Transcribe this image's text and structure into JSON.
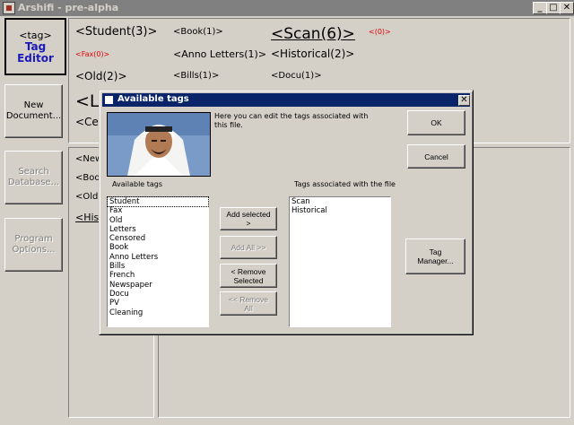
{
  "window": {
    "title": "Arshifi - pre-alpha",
    "controls": {
      "minimize": "_",
      "maximize": "□",
      "close": "✕"
    }
  },
  "nav": {
    "tag_editor": {
      "line1": "<tag>",
      "line2": "Tag",
      "line3": "Editor"
    },
    "new_document": {
      "line1": "New",
      "line2": "Document..."
    },
    "search_database": {
      "line1": "Search",
      "line2": "Database..."
    },
    "program_options": {
      "line1": "Program",
      "line2": "Options..."
    }
  },
  "tag_cloud": {
    "student": "<Student(3)>",
    "book": "<Book(1)>",
    "scan": "<Scan(6)>",
    "zero": "<(0)>",
    "fax": "<Fax(0)>",
    "anno_letters": "<Anno Letters(1)>",
    "historical": "<Historical(2)>",
    "old": "<Old(2)>",
    "bills": "<Bills(1)>",
    "docu": "<Docu(1)>",
    "le": "<Le",
    "ce": "<Ce"
  },
  "lower_panel": {
    "items": [
      "<New",
      "<Boo",
      "<Old(",
      "<Hist"
    ]
  },
  "dialog": {
    "title": "Available tags",
    "close_glyph": "✕",
    "description": "Here you can edit the tags associated with this file.",
    "available_label": "Available tags",
    "associated_label": "Tags associated with the file",
    "available_tags": [
      "Student",
      "Fax",
      "Old",
      "Letters",
      "Censored",
      "Book",
      "Anno Letters",
      "Bills",
      "French",
      "Newspaper",
      "Docu",
      "PV",
      "Cleaning"
    ],
    "associated_tags": [
      "Scan",
      "Historical"
    ],
    "buttons": {
      "ok": "OK",
      "cancel": "Cancel",
      "add_selected": "Add selected >",
      "add_all": "Add All >>",
      "remove_selected_1": "< Remove",
      "remove_selected_2": "Selected",
      "remove_all": "<< Remove All",
      "tag_manager": "Tag Manager..."
    }
  },
  "colors": {
    "face": "#d4d0c8",
    "dialog_title": "#0a246a",
    "tag_editor_text": "#1a1ab8",
    "red_tag": "#e00000"
  }
}
